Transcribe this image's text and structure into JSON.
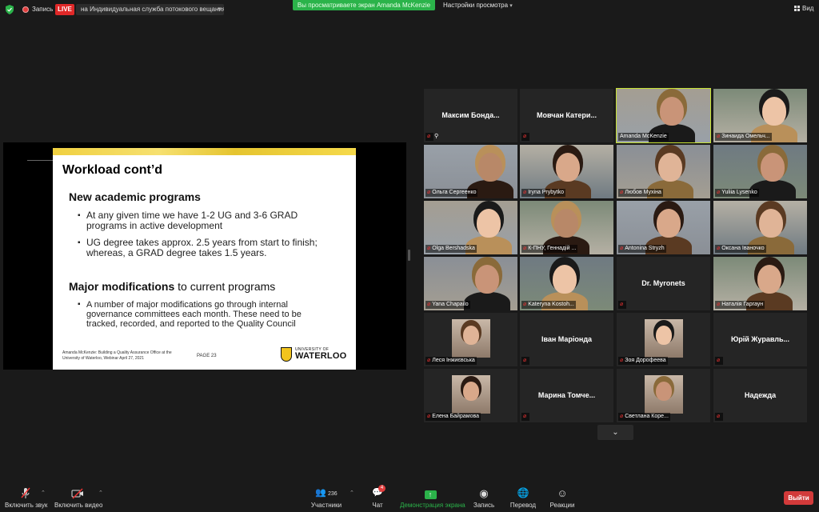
{
  "topbar": {
    "record_label": "Запись",
    "live_badge": "LIVE",
    "stream_target": "на Индивидуальная служба потокового вещания",
    "viewing_banner": "Вы просматриваете экран Amanda McKenzie",
    "view_settings": "Настройки просмотра",
    "view_button": "Вид"
  },
  "slide": {
    "title": "Workload cont’d",
    "section1": "New academic programs",
    "bullets1": [
      "At any given time we have 1-2 UG and 3-6 GRAD programs in active development",
      "UG degree takes approx. 2.5 years from start to finish; whereas, a GRAD degree takes 1.5 years."
    ],
    "section2_bold": "Major modifications",
    "section2_rest": " to current programs",
    "bullets2": [
      "A number of major modifications go through internal governance committees each month. These need to be tracked, recorded, and reported to the Quality Council"
    ],
    "footer": "Amanda McKenzie: Building a Quality Assurance Office at the University of Waterloo, Webinar April 27, 2021",
    "page": "PAGE 23",
    "logo_small": "UNIVERSITY OF",
    "logo_big": "WATERLOO"
  },
  "participants": [
    {
      "name": "Максим Бонда...",
      "label": "",
      "video": false,
      "muted": true,
      "pinned": true
    },
    {
      "name": "Мовчан Катери...",
      "label": "",
      "video": false,
      "muted": true
    },
    {
      "name": "",
      "label": "Amanda McKenzie",
      "video": true,
      "muted": false,
      "active": true
    },
    {
      "name": "",
      "label": "Зинаида Омельч...",
      "video": true,
      "muted": true
    },
    {
      "name": "",
      "label": "Ольга Сергеенко",
      "video": true,
      "muted": true
    },
    {
      "name": "",
      "label": "Iryna Prybytko",
      "video": true,
      "muted": true
    },
    {
      "name": "",
      "label": "Любов Мухіна",
      "video": true,
      "muted": true
    },
    {
      "name": "",
      "label": "Yuliia Lysenko",
      "video": true,
      "muted": true
    },
    {
      "name": "",
      "label": "Olga Bershadska",
      "video": true,
      "muted": true
    },
    {
      "name": "",
      "label": "К-ПНУ, Геннадій ...",
      "video": true,
      "muted": true
    },
    {
      "name": "",
      "label": "Antonina Stryzh",
      "video": true,
      "muted": true
    },
    {
      "name": "",
      "label": "Оксана Іваночко",
      "video": true,
      "muted": true
    },
    {
      "name": "",
      "label": "Yana Chapailo",
      "video": true,
      "muted": true
    },
    {
      "name": "",
      "label": "Kateryna Kostoh...",
      "video": true,
      "muted": true
    },
    {
      "name": "Dr. Myronets",
      "label": "",
      "video": false,
      "muted": true
    },
    {
      "name": "",
      "label": "Наталія Гаргаун",
      "video": true,
      "muted": true
    },
    {
      "name": "",
      "label": "Леся Інжиєвська",
      "video": false,
      "photo": true,
      "muted": true
    },
    {
      "name": "Іван Маріонда",
      "label": "",
      "video": false,
      "muted": true
    },
    {
      "name": "",
      "label": "Зоя Дорофеева",
      "video": false,
      "photo": true,
      "muted": true
    },
    {
      "name": "Юрій Журавль...",
      "label": "",
      "video": false,
      "muted": true
    },
    {
      "name": "",
      "label": "Елена Байрамова",
      "video": false,
      "photo": true,
      "muted": true
    },
    {
      "name": "Марина Томче...",
      "label": "",
      "video": false,
      "muted": true
    },
    {
      "name": "",
      "label": "Светлана Коре...",
      "video": false,
      "photo": true,
      "muted": true
    },
    {
      "name": "Надежда",
      "label": "",
      "video": false,
      "muted": true
    }
  ],
  "toolbar": {
    "unmute": "Включить звук",
    "start_video": "Включить видео",
    "participants_count": "236",
    "participants": "Участники",
    "chat_count": "4",
    "chat": "Чат",
    "share": "Демонстрация экрана",
    "record": "Запись",
    "translate": "Перевод",
    "reactions": "Реакции",
    "exit": "Выйти"
  },
  "colors": {
    "live": "#e02828",
    "banner": "#2bb34a",
    "active_speaker": "#c7e233",
    "exit": "#d23a3a"
  }
}
